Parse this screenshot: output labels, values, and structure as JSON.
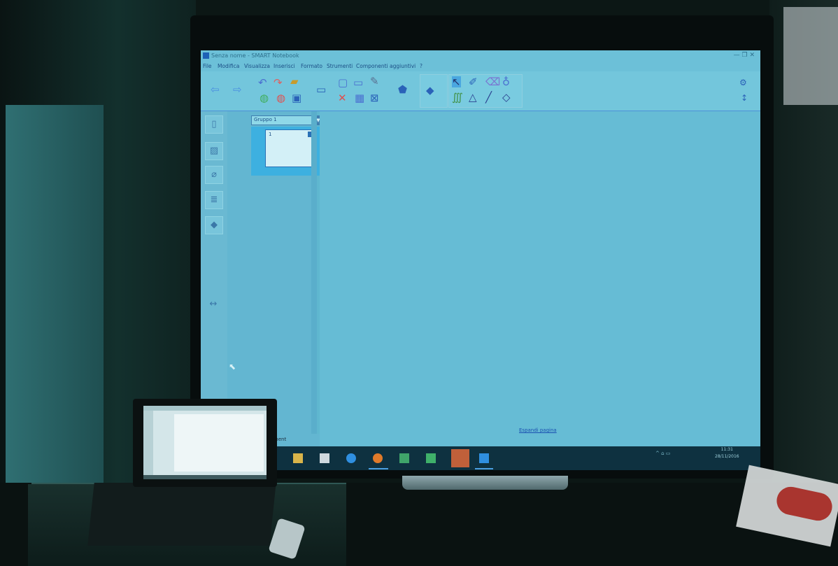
{
  "window": {
    "title": "Senza nome - SMART Notebook",
    "controls": "—   ❐   ✕"
  },
  "menu": [
    "File",
    "Modifica",
    "Visualizza",
    "Inserisci",
    "Formato",
    "Strumenti",
    "Componenti aggiuntivi",
    "?"
  ],
  "sorter": {
    "group_label": "Gruppo 1",
    "page_number": "1",
    "auto_hide_label": "maticament"
  },
  "canvas": {
    "expand_link": "Espandi pagina"
  },
  "taskbar": {
    "clock_time": "11:31",
    "clock_date": "28/11/2016"
  },
  "icons": {
    "back": "arrow-left-icon",
    "forward": "arrow-right-icon",
    "undo": "undo-icon",
    "redo": "redo-icon",
    "open": "folder-icon",
    "save": "save-icon",
    "select": "select-arrow-icon",
    "pen": "pen-icon",
    "eraser": "eraser-icon",
    "line": "line-icon",
    "shape": "triangle-icon"
  },
  "colors": {
    "screen": "#5fb7cf",
    "accent": "#1e61b6"
  }
}
